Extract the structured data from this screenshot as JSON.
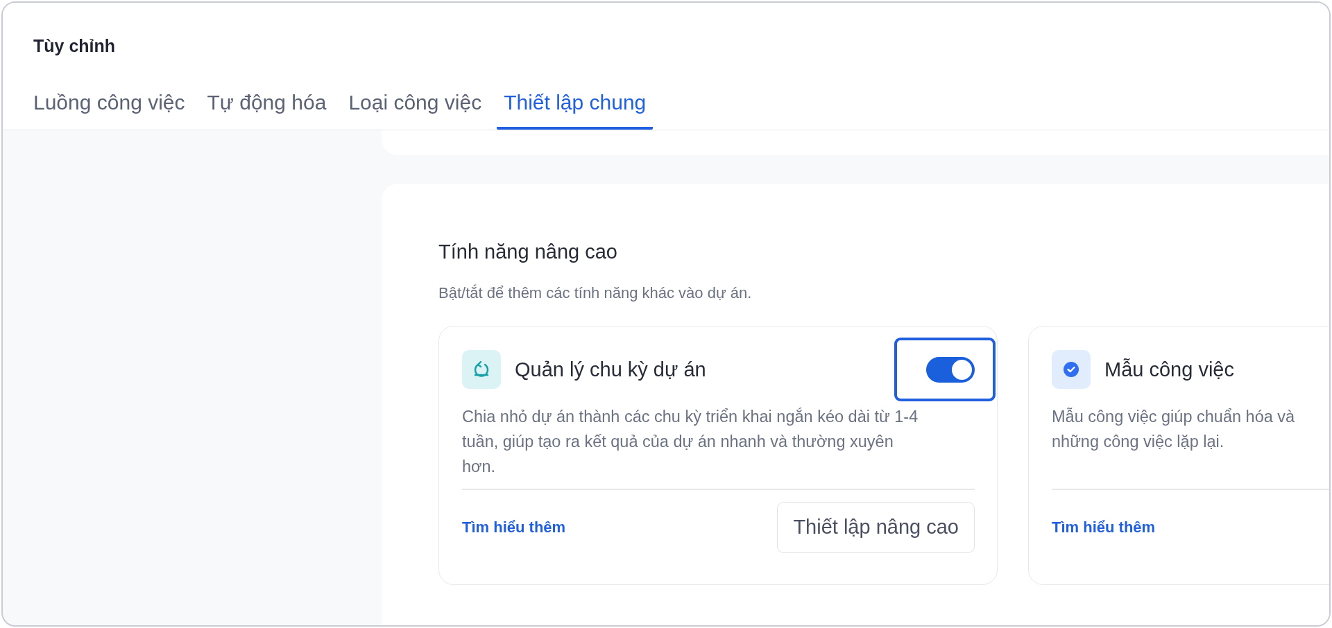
{
  "header": {
    "title": "Tùy chỉnh"
  },
  "tabs": [
    {
      "label": "Luồng công việc",
      "selected": false
    },
    {
      "label": "Tự động hóa",
      "selected": false
    },
    {
      "label": "Loại công việc",
      "selected": false
    },
    {
      "label": "Thiết lập chung",
      "selected": true
    }
  ],
  "section": {
    "title": "Tính năng nâng cao",
    "subtitle": "Bật/tắt để thêm các tính năng khác vào dự án."
  },
  "features": [
    {
      "kind": "cycle",
      "title": "Quản lý chu kỳ dự án",
      "toggle": {
        "on": true,
        "focused": true
      },
      "description_lines": [
        "Chia nhỏ dự án thành các chu kỳ triển khai ngắn kéo dài từ 1-4",
        "tuần, giúp tạo ra kết quả của dự án nhanh và thường xuyên",
        "hơn."
      ],
      "link": "Tìm hiểu thêm",
      "button": "Thiết lập nâng cao"
    },
    {
      "kind": "check",
      "title": "Mẫu công việc",
      "description_lines": [
        "Mẫu công việc giúp chuẩn hóa và",
        "những công việc lặp lại."
      ],
      "link": "Tìm hiểu thêm"
    }
  ]
}
